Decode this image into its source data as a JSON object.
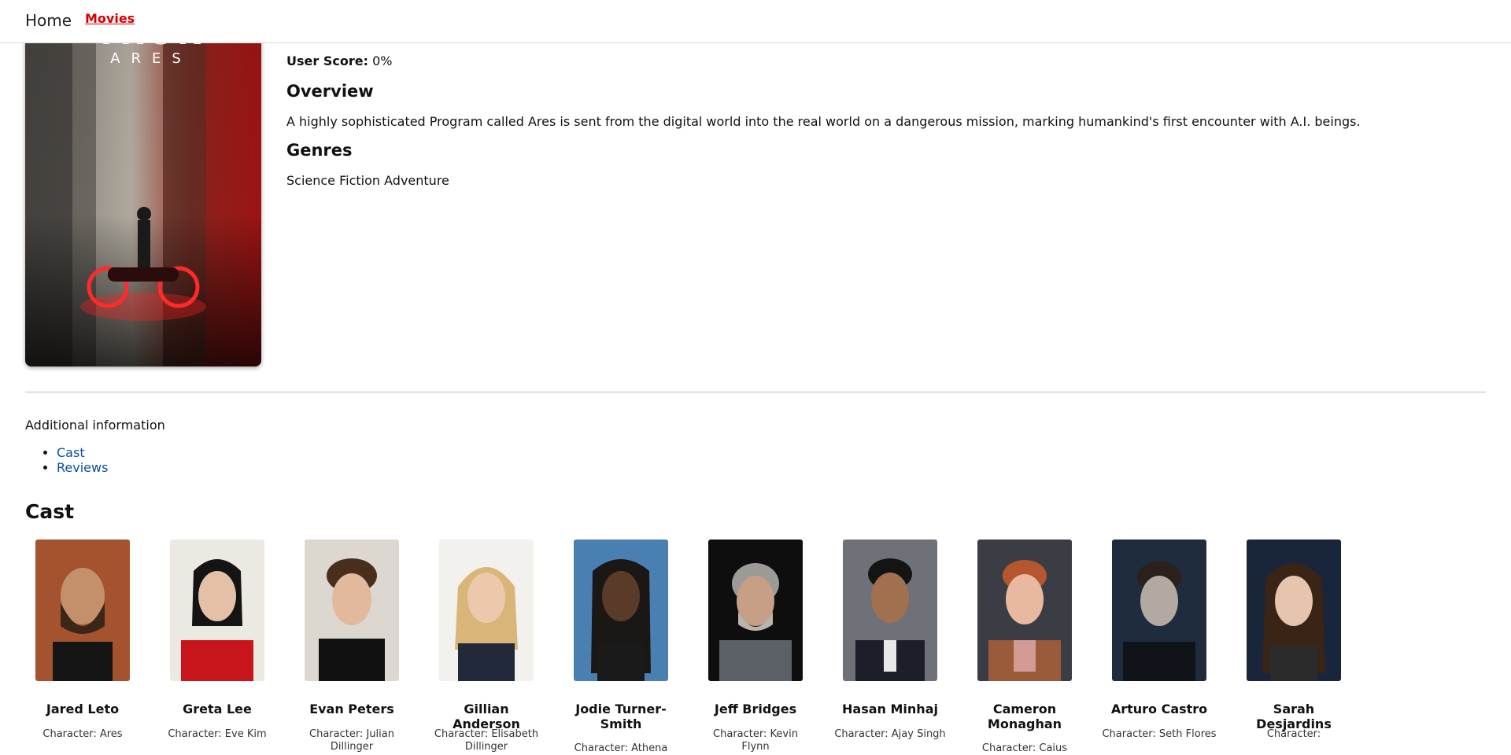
{
  "nav": {
    "home": "Home",
    "movies": "Movies"
  },
  "poster": {
    "logo_line1": "TRON",
    "logo_line2": "ARES"
  },
  "movie": {
    "score_label": "User Score:",
    "score_value": "0%",
    "overview_heading": "Overview",
    "overview_text": "A highly sophisticated Program called Ares is sent from the digital world into the real world on a dangerous mission, marking humankind's first encounter with A.I. beings.",
    "genres_heading": "Genres",
    "genres_text": "Science Fiction Adventure"
  },
  "additional": {
    "title": "Additional information",
    "links": [
      "Cast",
      "Reviews"
    ]
  },
  "cast": {
    "title": "Cast",
    "members": [
      {
        "name": "Jared Leto",
        "character": "Character: Ares"
      },
      {
        "name": "Greta Lee",
        "character": "Character: Eve Kim"
      },
      {
        "name": "Evan Peters",
        "character": "Character: Julian Dillinger"
      },
      {
        "name": "Gillian Anderson",
        "character": "Character: Elisabeth Dillinger"
      },
      {
        "name": "Jodie Turner-Smith",
        "character": "Character: Athena"
      },
      {
        "name": "Jeff Bridges",
        "character": "Character: Kevin Flynn"
      },
      {
        "name": "Hasan Minhaj",
        "character": "Character: Ajay Singh"
      },
      {
        "name": "Cameron Monaghan",
        "character": "Character: Caius"
      },
      {
        "name": "Arturo Castro",
        "character": "Character: Seth Flores"
      },
      {
        "name": "Sarah Desjardins",
        "character": "Character:"
      }
    ]
  },
  "colors": {
    "accent": "#d40000",
    "link": "#0a4fa6"
  }
}
